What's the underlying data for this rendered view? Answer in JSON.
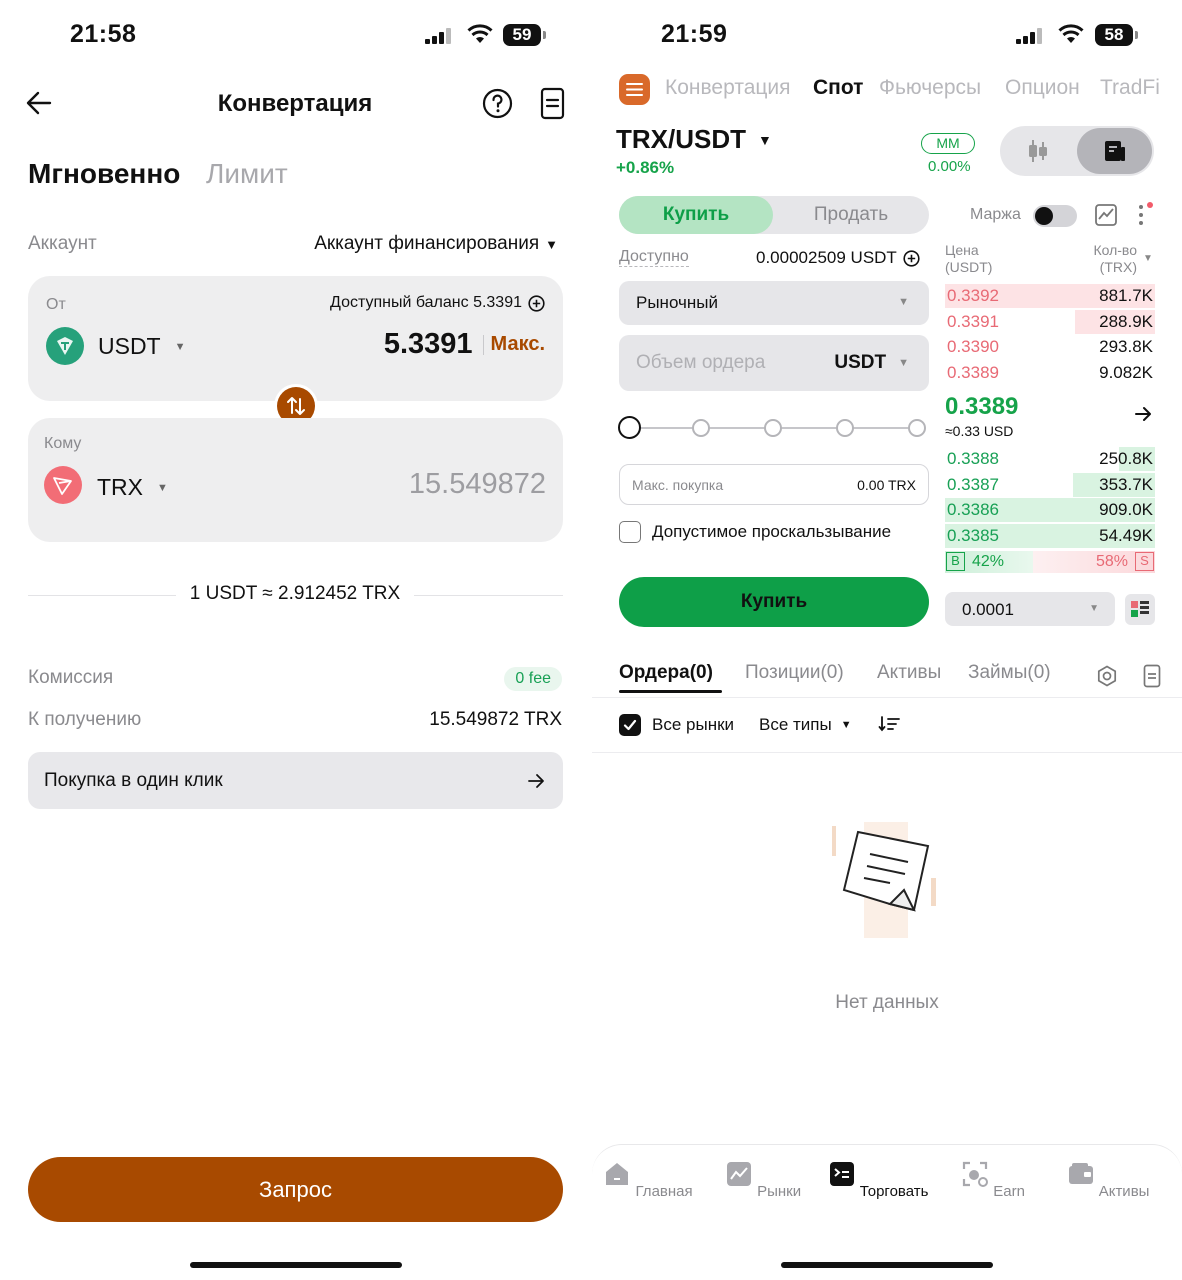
{
  "left": {
    "status": {
      "time": "21:58",
      "battery": "59"
    },
    "header": {
      "title": "Конвертация",
      "back_icon": "arrow-left-icon",
      "help_icon": "question-circle-icon",
      "history_icon": "document-icon"
    },
    "mode_tabs": {
      "instant": "Мгновенно",
      "limit": "Лимит"
    },
    "account": {
      "label": "Аккаунт",
      "value": "Аккаунт финансирования"
    },
    "from": {
      "label": "От",
      "balance_text": "Доступный баланс 5.3391",
      "currency": "USDT",
      "amount": "5.3391",
      "max_label": "Макс."
    },
    "to": {
      "label": "Кому",
      "currency": "TRX",
      "amount": "15.549872"
    },
    "rate": "1 USDT ≈ 2.912452 TRX",
    "fee": {
      "label": "Комиссия",
      "badge": "0 fee"
    },
    "receive": {
      "label": "К получению",
      "value": "15.549872 TRX"
    },
    "one_click": {
      "label": "Покупка в один клик"
    },
    "submit": {
      "label": "Запрос"
    },
    "colors": {
      "accent": "#a84a00",
      "usdt": "#26a17b",
      "trx": "#f26d76",
      "fee_green": "#18a055"
    }
  },
  "right": {
    "status": {
      "time": "21:59",
      "battery": "58"
    },
    "top_tabs": [
      "Конвертация",
      "Спот",
      "Фьючерсы",
      "Опцион",
      "TradFi"
    ],
    "active_top_tab": "Спот",
    "pair": {
      "name": "TRX/USDT",
      "change": "+0.86%",
      "mm_label": "MM",
      "mm_value": "0.00%"
    },
    "order_side": {
      "buy": "Купить",
      "sell": "Продать"
    },
    "margin_label": "Маржа",
    "available": {
      "label": "Доступно",
      "value": "0.00002509 USDT"
    },
    "order_type": "Рыночный",
    "volume": {
      "placeholder": "Объем ордера",
      "currency": "USDT"
    },
    "slider_percent": 0,
    "max_buy": {
      "label": "Макс. покупка",
      "value": "0.00 TRX"
    },
    "slippage_label": "Допустимое проскальзывание",
    "buy_button": "Купить",
    "orderbook": {
      "price_header": "Цена\n(USDT)",
      "qty_header": "Кол-во\n(TRX)",
      "asks": [
        {
          "price": "0.3392",
          "qty": "881.7K",
          "depth": 1.0
        },
        {
          "price": "0.3391",
          "qty": "288.9K",
          "depth": 0.38
        },
        {
          "price": "0.3390",
          "qty": "293.8K",
          "depth": 0.0
        },
        {
          "price": "0.3389",
          "qty": "9.082K",
          "depth": 0.0
        }
      ],
      "last_price": "0.3389",
      "last_price_usd": "≈0.33 USD",
      "bids": [
        {
          "price": "0.3388",
          "qty": "250.8K",
          "depth": 0.17
        },
        {
          "price": "0.3387",
          "qty": "353.7K",
          "depth": 0.39
        },
        {
          "price": "0.3386",
          "qty": "909.0K",
          "depth": 1.0
        },
        {
          "price": "0.3385",
          "qty": "54.49K",
          "depth": 1.0
        }
      ],
      "buy_ratio": {
        "tag": "B",
        "value": "42%"
      },
      "sell_ratio": {
        "tag": "S",
        "value": "58%"
      },
      "precision": "0.0001"
    },
    "bottom_tabs": [
      "Ордера(0)",
      "Позиции(0)",
      "Активы",
      "Займы(0)"
    ],
    "filters": {
      "all_markets": "Все рынки",
      "all_types": "Все типы"
    },
    "empty_text": "Нет данных",
    "nav": [
      {
        "label": "Главная",
        "icon": "home-icon"
      },
      {
        "label": "Рынки",
        "icon": "chart-icon"
      },
      {
        "label": "Торговать",
        "icon": "trade-icon"
      },
      {
        "label": "Earn",
        "icon": "earn-icon"
      },
      {
        "label": "Активы",
        "icon": "wallet-icon"
      }
    ],
    "active_nav": "Торговать",
    "colors": {
      "green": "#16a34a",
      "buy_button": "#0e9f48",
      "red": "#e86a75",
      "brand": "#d9692a"
    }
  }
}
